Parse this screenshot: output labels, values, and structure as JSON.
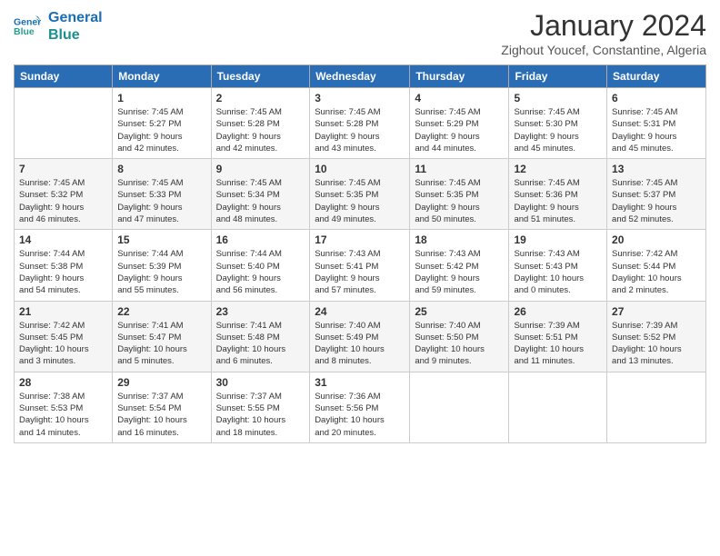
{
  "logo": {
    "line1": "General",
    "line2": "Blue"
  },
  "title": "January 2024",
  "subtitle": "Zighout Youcef, Constantine, Algeria",
  "days_header": [
    "Sunday",
    "Monday",
    "Tuesday",
    "Wednesday",
    "Thursday",
    "Friday",
    "Saturday"
  ],
  "weeks": [
    [
      {
        "day": "",
        "info": ""
      },
      {
        "day": "1",
        "info": "Sunrise: 7:45 AM\nSunset: 5:27 PM\nDaylight: 9 hours\nand 42 minutes."
      },
      {
        "day": "2",
        "info": "Sunrise: 7:45 AM\nSunset: 5:28 PM\nDaylight: 9 hours\nand 42 minutes."
      },
      {
        "day": "3",
        "info": "Sunrise: 7:45 AM\nSunset: 5:28 PM\nDaylight: 9 hours\nand 43 minutes."
      },
      {
        "day": "4",
        "info": "Sunrise: 7:45 AM\nSunset: 5:29 PM\nDaylight: 9 hours\nand 44 minutes."
      },
      {
        "day": "5",
        "info": "Sunrise: 7:45 AM\nSunset: 5:30 PM\nDaylight: 9 hours\nand 45 minutes."
      },
      {
        "day": "6",
        "info": "Sunrise: 7:45 AM\nSunset: 5:31 PM\nDaylight: 9 hours\nand 45 minutes."
      }
    ],
    [
      {
        "day": "7",
        "info": "Sunrise: 7:45 AM\nSunset: 5:32 PM\nDaylight: 9 hours\nand 46 minutes."
      },
      {
        "day": "8",
        "info": "Sunrise: 7:45 AM\nSunset: 5:33 PM\nDaylight: 9 hours\nand 47 minutes."
      },
      {
        "day": "9",
        "info": "Sunrise: 7:45 AM\nSunset: 5:34 PM\nDaylight: 9 hours\nand 48 minutes."
      },
      {
        "day": "10",
        "info": "Sunrise: 7:45 AM\nSunset: 5:35 PM\nDaylight: 9 hours\nand 49 minutes."
      },
      {
        "day": "11",
        "info": "Sunrise: 7:45 AM\nSunset: 5:35 PM\nDaylight: 9 hours\nand 50 minutes."
      },
      {
        "day": "12",
        "info": "Sunrise: 7:45 AM\nSunset: 5:36 PM\nDaylight: 9 hours\nand 51 minutes."
      },
      {
        "day": "13",
        "info": "Sunrise: 7:45 AM\nSunset: 5:37 PM\nDaylight: 9 hours\nand 52 minutes."
      }
    ],
    [
      {
        "day": "14",
        "info": "Sunrise: 7:44 AM\nSunset: 5:38 PM\nDaylight: 9 hours\nand 54 minutes."
      },
      {
        "day": "15",
        "info": "Sunrise: 7:44 AM\nSunset: 5:39 PM\nDaylight: 9 hours\nand 55 minutes."
      },
      {
        "day": "16",
        "info": "Sunrise: 7:44 AM\nSunset: 5:40 PM\nDaylight: 9 hours\nand 56 minutes."
      },
      {
        "day": "17",
        "info": "Sunrise: 7:43 AM\nSunset: 5:41 PM\nDaylight: 9 hours\nand 57 minutes."
      },
      {
        "day": "18",
        "info": "Sunrise: 7:43 AM\nSunset: 5:42 PM\nDaylight: 9 hours\nand 59 minutes."
      },
      {
        "day": "19",
        "info": "Sunrise: 7:43 AM\nSunset: 5:43 PM\nDaylight: 10 hours\nand 0 minutes."
      },
      {
        "day": "20",
        "info": "Sunrise: 7:42 AM\nSunset: 5:44 PM\nDaylight: 10 hours\nand 2 minutes."
      }
    ],
    [
      {
        "day": "21",
        "info": "Sunrise: 7:42 AM\nSunset: 5:45 PM\nDaylight: 10 hours\nand 3 minutes."
      },
      {
        "day": "22",
        "info": "Sunrise: 7:41 AM\nSunset: 5:47 PM\nDaylight: 10 hours\nand 5 minutes."
      },
      {
        "day": "23",
        "info": "Sunrise: 7:41 AM\nSunset: 5:48 PM\nDaylight: 10 hours\nand 6 minutes."
      },
      {
        "day": "24",
        "info": "Sunrise: 7:40 AM\nSunset: 5:49 PM\nDaylight: 10 hours\nand 8 minutes."
      },
      {
        "day": "25",
        "info": "Sunrise: 7:40 AM\nSunset: 5:50 PM\nDaylight: 10 hours\nand 9 minutes."
      },
      {
        "day": "26",
        "info": "Sunrise: 7:39 AM\nSunset: 5:51 PM\nDaylight: 10 hours\nand 11 minutes."
      },
      {
        "day": "27",
        "info": "Sunrise: 7:39 AM\nSunset: 5:52 PM\nDaylight: 10 hours\nand 13 minutes."
      }
    ],
    [
      {
        "day": "28",
        "info": "Sunrise: 7:38 AM\nSunset: 5:53 PM\nDaylight: 10 hours\nand 14 minutes."
      },
      {
        "day": "29",
        "info": "Sunrise: 7:37 AM\nSunset: 5:54 PM\nDaylight: 10 hours\nand 16 minutes."
      },
      {
        "day": "30",
        "info": "Sunrise: 7:37 AM\nSunset: 5:55 PM\nDaylight: 10 hours\nand 18 minutes."
      },
      {
        "day": "31",
        "info": "Sunrise: 7:36 AM\nSunset: 5:56 PM\nDaylight: 10 hours\nand 20 minutes."
      },
      {
        "day": "",
        "info": ""
      },
      {
        "day": "",
        "info": ""
      },
      {
        "day": "",
        "info": ""
      }
    ]
  ]
}
